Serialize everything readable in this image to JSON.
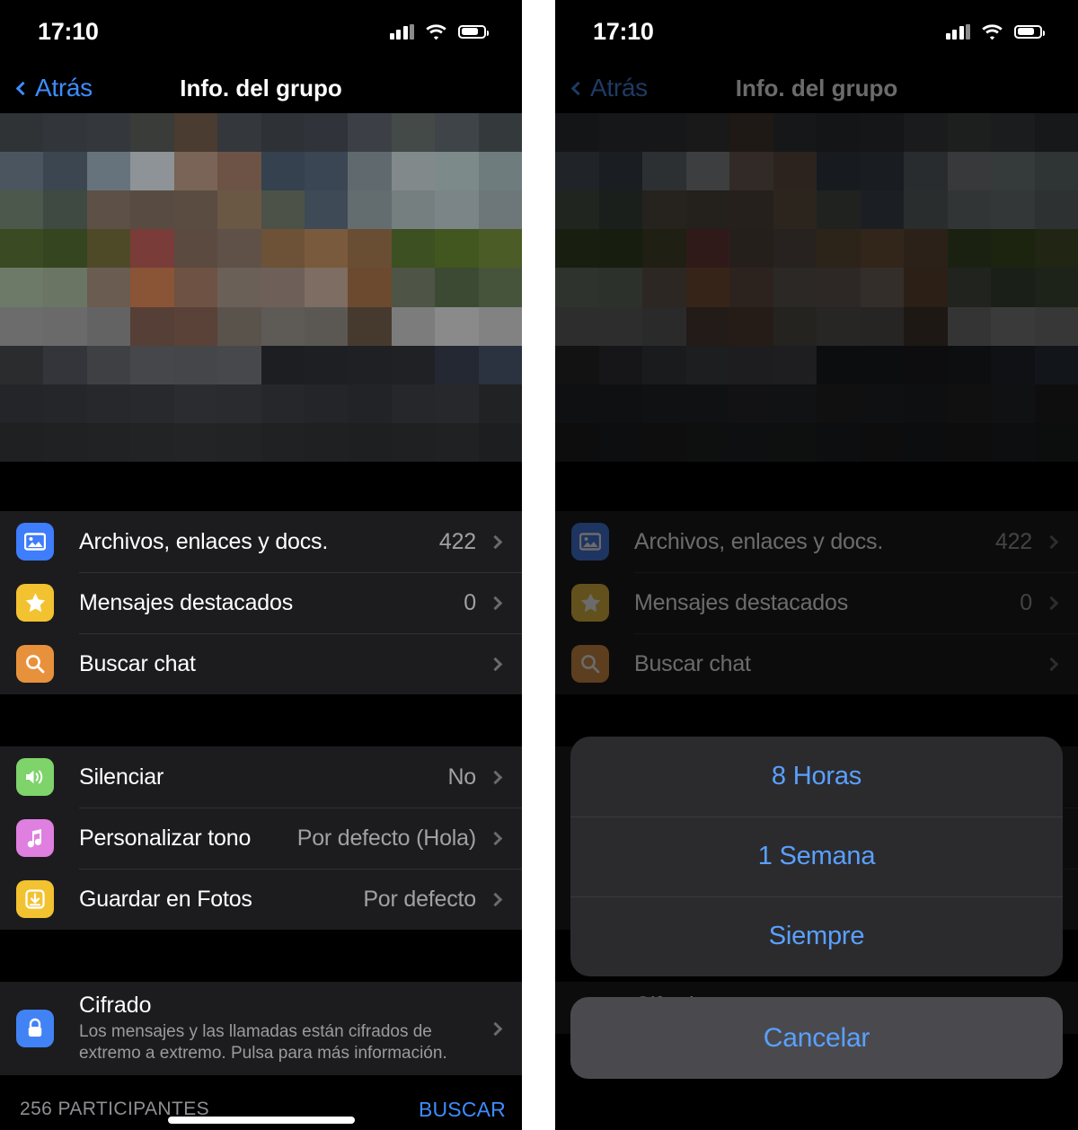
{
  "status_bar": {
    "time": "17:10",
    "signal_icon": "cellular-signal-icon",
    "wifi_icon": "wifi-icon",
    "battery_icon": "battery-icon",
    "battery_level_percent": 68
  },
  "nav": {
    "back_label": "Atrás",
    "title": "Info. del grupo",
    "back_icon": "chevron-left-icon"
  },
  "colors": {
    "accent_blue": "#3c8cff",
    "sheet_blue": "#5aa0ff",
    "row_bg": "#1c1c1e",
    "page_bg": "#000000",
    "icon_photos": "#3e7dfb",
    "icon_star": "#f2c230",
    "icon_search": "#e8913c",
    "icon_mute": "#7ed36a",
    "icon_tone": "#df7fe0",
    "icon_save": "#f2c230",
    "icon_lock": "#4183f5"
  },
  "sections": [
    {
      "name": "media-section",
      "rows": [
        {
          "icon": "photos-icon",
          "icon_color": "#3e7dfb",
          "label": "Archivos, enlaces y docs.",
          "value": "422"
        },
        {
          "icon": "star-icon",
          "icon_color": "#f2c230",
          "label": "Mensajes destacados",
          "value": "0"
        },
        {
          "icon": "search-icon",
          "icon_color": "#e8913c",
          "label": "Buscar chat",
          "value": ""
        }
      ]
    },
    {
      "name": "notifications-section",
      "rows": [
        {
          "icon": "speaker-icon",
          "icon_color": "#7ed36a",
          "label": "Silenciar",
          "value": "No"
        },
        {
          "icon": "music-note-icon",
          "icon_color": "#df7fe0",
          "label": "Personalizar tono",
          "value": "Por defecto (Hola)"
        },
        {
          "icon": "download-icon",
          "icon_color": "#f2c230",
          "label": "Guardar en Fotos",
          "value": "Por defecto"
        }
      ]
    }
  ],
  "encryption": {
    "icon": "lock-icon",
    "icon_color": "#4183f5",
    "title": "Cifrado",
    "description": "Los mensajes y las llamadas están cifrados de extremo a extremo. Pulsa para más información."
  },
  "bottom_bar": {
    "participants": "256 PARTICIPANTES",
    "search_label": "BUSCAR"
  },
  "action_sheet": {
    "options": [
      {
        "label": "8 Horas"
      },
      {
        "label": "1 Semana"
      },
      {
        "label": "Siempre"
      }
    ],
    "cancel_label": "Cancelar"
  }
}
